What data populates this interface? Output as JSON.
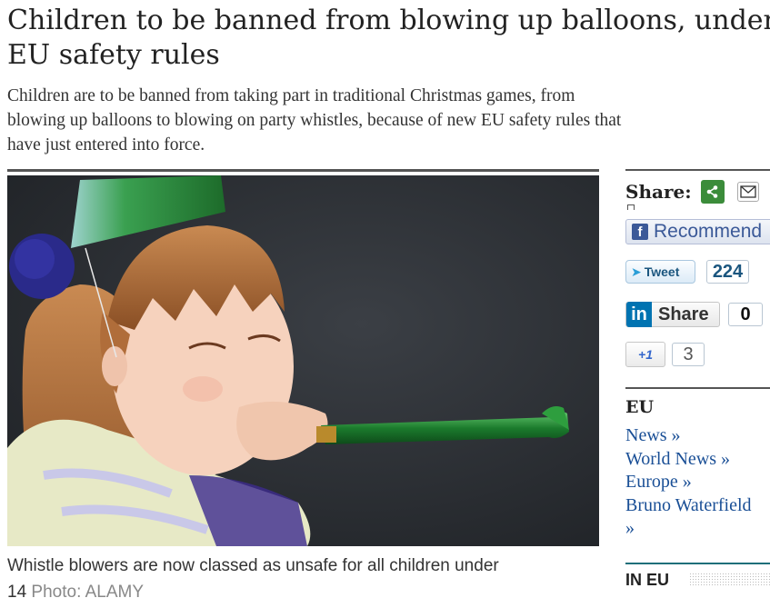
{
  "article": {
    "headline_line1": "Children to be banned from blowing up balloons, under",
    "headline_line2": "EU safety rules",
    "standfirst_line1": "Children are to be banned from taking part in traditional Christmas games, from",
    "standfirst_line2": "blowing up balloons to blowing on party whistles, because of new EU safety rules that",
    "standfirst_line3": "have just entered into force.",
    "caption_text": "Whistle blowers are now classed as unsafe for all children under",
    "caption_number": "14",
    "caption_credit": "Photo: ALAMY"
  },
  "share": {
    "label": "Share:",
    "facebook_label": "Recommend",
    "tweet_label": "Tweet",
    "tweet_count": "224",
    "linkedin_label": "Share",
    "linkedin_count": "0",
    "gplus_label": "+1",
    "gplus_count": "3"
  },
  "sidebar": {
    "section_title": "EU",
    "links": [
      "News »",
      "World News »",
      "Europe »",
      "Bruno Waterfield",
      "»"
    ],
    "in_eu_title": "IN EU"
  },
  "colors": {
    "link": "#1a4f96",
    "facebook": "#3b5998",
    "linkedin": "#0073b1",
    "share_green": "#3b8c3a",
    "in_eu_rule": "#1f6f7a"
  },
  "icons": [
    "share-icon",
    "mail-icon",
    "facebook-icon",
    "twitter-bird-icon",
    "linkedin-icon"
  ]
}
